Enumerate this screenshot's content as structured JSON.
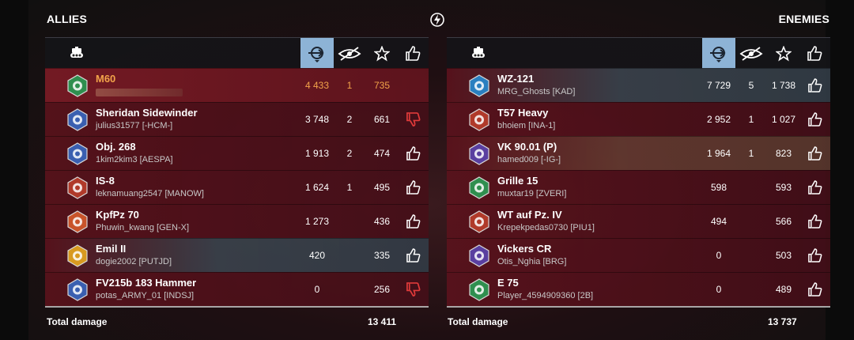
{
  "allies": {
    "title": "ALLIES",
    "total_label": "Total damage",
    "total_value": "13 411",
    "rows": [
      {
        "tank": "M60",
        "player": "",
        "damage": "4 433",
        "spotted": "1",
        "xp": "735",
        "like": "",
        "me": true
      },
      {
        "tank": "Sheridan Sidewinder",
        "player": "julius31577 [-HCM-]",
        "damage": "3 748",
        "spotted": "2",
        "xp": "661",
        "like": "dislike"
      },
      {
        "tank": "Obj. 268",
        "player": "1kim2kim3 [AESPA]",
        "damage": "1 913",
        "spotted": "2",
        "xp": "474",
        "like": "like"
      },
      {
        "tank": "IS-8",
        "player": "leknamuang2547 [MANOW]",
        "damage": "1 624",
        "spotted": "1",
        "xp": "495",
        "like": "like"
      },
      {
        "tank": "KpfPz 70",
        "player": "Phuwin_kwang [GEN-X]",
        "damage": "1 273",
        "spotted": "",
        "xp": "436",
        "like": "like"
      },
      {
        "tank": "Emil II",
        "player": "dogie2002 [PUTJD]",
        "damage": "420",
        "spotted": "",
        "xp": "335",
        "like": "like"
      },
      {
        "tank": "FV215b 183 Hammer",
        "player": "potas_ARMY_01 [INDSJ]",
        "damage": "0",
        "spotted": "",
        "xp": "256",
        "like": "dislike"
      }
    ]
  },
  "enemies": {
    "title": "ENEMIES",
    "total_label": "Total damage",
    "total_value": "13 737",
    "rows": [
      {
        "tank": "WZ-121",
        "player": "MRG_Ghosts [KAD]",
        "damage": "7 729",
        "spotted": "5",
        "xp": "1 738",
        "like": "like"
      },
      {
        "tank": "T57 Heavy",
        "player": "bhoiem [INA-1]",
        "damage": "2 952",
        "spotted": "1",
        "xp": "1 027",
        "like": "like"
      },
      {
        "tank": "VK 90.01 (P)",
        "player": "hamed009 [-IG-]",
        "damage": "1 964",
        "spotted": "1",
        "xp": "823",
        "like": "like"
      },
      {
        "tank": "Grille 15",
        "player": "muxtar19 [ZVERI]",
        "damage": "598",
        "spotted": "",
        "xp": "593",
        "like": "like"
      },
      {
        "tank": "WT auf Pz. IV",
        "player": "Krepekpedas0730 [PIU1]",
        "damage": "494",
        "spotted": "",
        "xp": "566",
        "like": "like"
      },
      {
        "tank": "Vickers CR",
        "player": "Otis_Nghia [BRG]",
        "damage": "0",
        "spotted": "",
        "xp": "503",
        "like": "like"
      },
      {
        "tank": "E 75",
        "player": "Player_4594909360 [2B]",
        "damage": "0",
        "spotted": "",
        "xp": "489",
        "like": "like"
      }
    ]
  },
  "colors": {
    "accent_me": "#f2a34a",
    "active_header": "#8db3d6",
    "dislike": "#e03a3a"
  },
  "header_icons": [
    "tank-icon",
    "damage-icon",
    "spotting-icon",
    "xp-star-icon",
    "thumbs-up-icon"
  ]
}
